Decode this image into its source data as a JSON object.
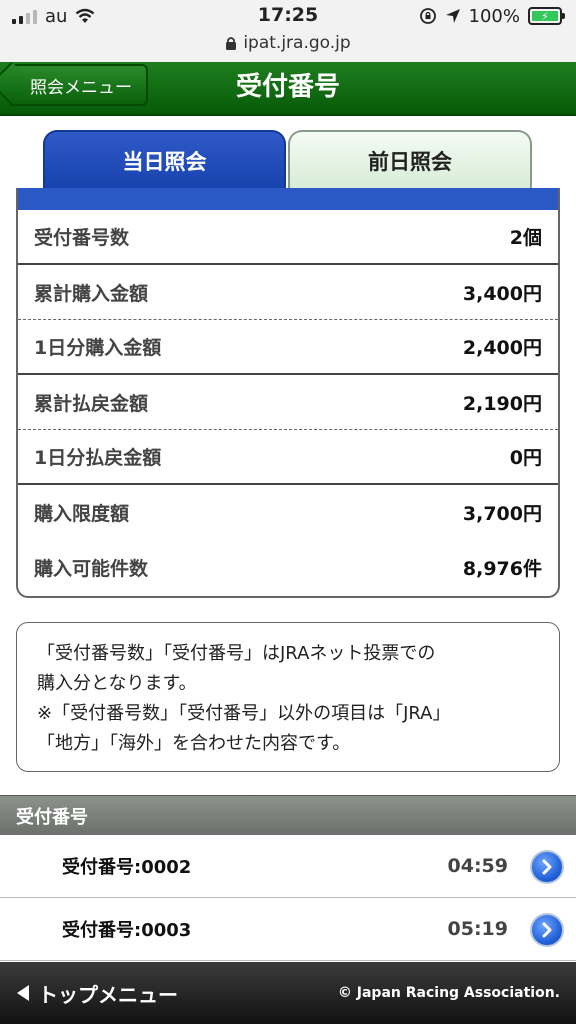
{
  "status_bar": {
    "carrier": "au",
    "time": "17:25",
    "battery_pct": "100%",
    "url": "ipat.jra.go.jp"
  },
  "header": {
    "back_label": "照会メニュー",
    "title": "受付番号"
  },
  "tabs": {
    "today": "当日照会",
    "previous": "前日照会",
    "active": "today"
  },
  "summary": {
    "rows": [
      {
        "label": "受付番号数",
        "value": "2個"
      },
      {
        "label": "累計購入金額",
        "value": "3,400円"
      },
      {
        "label": "1日分購入金額",
        "value": "2,400円"
      },
      {
        "label": "累計払戻金額",
        "value": "2,190円"
      },
      {
        "label": "1日分払戻金額",
        "value": "0円"
      },
      {
        "label": "購入限度額",
        "value": "3,700円"
      },
      {
        "label": "購入可能件数",
        "value": "8,976件"
      }
    ]
  },
  "note": {
    "line1": "「受付番号数」「受付番号」はJRAネット投票での",
    "line2": "購入分となります。",
    "line3": "※「受付番号数」「受付番号」以外の項目は「JRA」",
    "line4": "「地方」「海外」を合わせた内容です。"
  },
  "numbers_section": {
    "title": "受付番号",
    "items": [
      {
        "label": "受付番号:0002",
        "time": "04:59"
      },
      {
        "label": "受付番号:0003",
        "time": "05:19"
      }
    ]
  },
  "footer": {
    "menu_label": "トップメニュー",
    "copyright": "© Japan Racing Association."
  },
  "colors": {
    "header_green": "#0a600a",
    "tab_blue": "#1f4fbf",
    "section_gray": "#7a7f7a",
    "footer_dark": "#1a1a1a"
  }
}
